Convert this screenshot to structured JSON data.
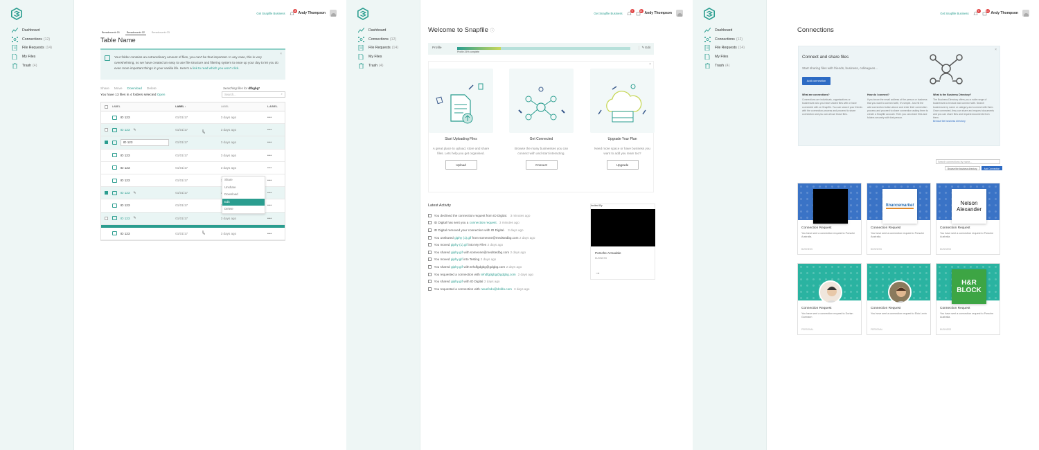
{
  "colors": {
    "teal": "#2a9d8f",
    "blue": "#2e6bc4",
    "sidebar_bg": "#eef6f5",
    "badge": "#e04040"
  },
  "header": {
    "get_business": "Get Snapfile Business",
    "user_name": "Andy Thompson",
    "notif_count": "14",
    "notif_count_a": "9",
    "notif_count_b": "14"
  },
  "nav": {
    "items": [
      {
        "label": "Dashboard",
        "count": ""
      },
      {
        "label": "Connections",
        "count": "(12)"
      },
      {
        "label": "File Requests",
        "count": "(14)"
      },
      {
        "label": "My Files",
        "count": ""
      },
      {
        "label": "Trash",
        "count": "(4)"
      }
    ]
  },
  "files": {
    "breadcrumbs": [
      "Breadcrumb 01",
      "Breadcrumb 02",
      "Breadcrumb 03"
    ],
    "title": "Table Name",
    "info_text": "Your folder contains an extraordinary amount of files, you can't be that important. In any case, this is very overwhelming, so we have created an easy to use file structure and filtering system to ease up your day to let you do even more important things in your vanilla life. Here's a",
    "info_link": "link to read which you won't click.",
    "actions": [
      "Share",
      "Move",
      "Download",
      "Delete"
    ],
    "selection_info": "You have 13 files in 4 folders selected",
    "selection_link": "Open",
    "search_label": "Searching files for",
    "search_term": "dfbgbg*",
    "search_placeholder": "Search...",
    "columns": [
      "LABEL",
      "LABEL ↑",
      "LABEL",
      "LABEL"
    ],
    "rows": [
      {
        "name": "ID 123",
        "date": "01/01/17",
        "modified": "3 days ago",
        "more": "•••"
      },
      {
        "name": "ID 123",
        "date": "01/01/17",
        "modified": "3 days ago",
        "more": "•••"
      },
      {
        "name": "ID 123",
        "date": "01/01/17",
        "modified": "3 days ago",
        "more": "•••"
      },
      {
        "name": "ID 123",
        "date": "01/01/17",
        "modified": "3 days ago",
        "more": "•••"
      },
      {
        "name": "ID 123",
        "date": "01/01/17",
        "modified": "3 days ago",
        "more": "•••"
      },
      {
        "name": "ID 123",
        "date": "01/01/17",
        "modified": "3 days ago",
        "more": "•••"
      },
      {
        "name": "ID 123",
        "date": "01/01/17",
        "modified": "3 days ago",
        "more": "•••"
      },
      {
        "name": "ID 123",
        "date": "01/01/17",
        "modified": "3 days ago",
        "more": "•••"
      },
      {
        "name": "ID 123",
        "date": "01/01/17",
        "modified": "3 days ago",
        "more": "•••"
      },
      {
        "name": "ID 123",
        "date": "01/01/17",
        "modified": "3 days ago",
        "more": "•••"
      }
    ],
    "context_menu": [
      "Share",
      "Unshare",
      "Download",
      "Edit",
      "Delete"
    ]
  },
  "dashboard": {
    "title": "Welcome to Snapfile",
    "profile_label": "Profile",
    "profile_percent": "Profile 25% complete",
    "profile_progress": 0.25,
    "edit": "Edit",
    "cards": [
      {
        "title": "Start Uploading Files",
        "desc": "A great place to upload, store and share files. Lets help you get organised.",
        "button": "Upload"
      },
      {
        "title": "Get Connected",
        "desc": "Browse the many businesses you can connect with and start interacting.",
        "button": "Connect"
      },
      {
        "title": "Upgrade Your Plan",
        "desc": "Need more space or have business you want to add you team too?",
        "button": "Upgrade"
      }
    ],
    "activity_title": "Latest Activity",
    "activity": [
      {
        "pre": "You declined the connection request from ID Digital.",
        "link": "",
        "post": "",
        "time": "3 minutes ago"
      },
      {
        "pre": "ID Digital has sent you a",
        "link": "connection request.",
        "post": "",
        "time": "3 minutes ago"
      },
      {
        "pre": "ID Digital removed your connection with ID Digital.",
        "link": "",
        "post": "",
        "time": "3 days ago"
      },
      {
        "pre": "You unshared",
        "link": "giphy (1).gif",
        "post": "from someone@medstedbg.com",
        "time": "2 days ago"
      },
      {
        "pre": "You moved",
        "link": "giphy (1).gif",
        "post": "into My Files",
        "time": "2 days ago"
      },
      {
        "pre": "You shared",
        "link": "giphy.gif",
        "post": "with someone@medstedbg.com",
        "time": "2 days ago"
      },
      {
        "pre": "You moved",
        "link": "giphy.gif",
        "post": "into Testing",
        "time": "2 days ago"
      },
      {
        "pre": "You shared",
        "link": "giphy.gif",
        "post": "with tehdfgdgbg@gdgbg.com",
        "time": "2 days ago"
      },
      {
        "pre": "You requested a connection with",
        "link": "tehdfgdgbg@gdgbg.com",
        "post": "",
        "time": "2 days ago"
      },
      {
        "pre": "You shared",
        "link": "giphy.gif",
        "post": "with ID Digital",
        "time": "2 days ago"
      },
      {
        "pre": "You requested a connection with",
        "link": "rwuefcdo@dofdo.com",
        "post": "",
        "time": "3 days ago"
      }
    ],
    "invited_label": "Invited By",
    "invited_name": "Porsche Armadale",
    "invited_sub": "BUSINESS",
    "invited_arrow": "→"
  },
  "connections": {
    "title": "Connections",
    "panel_title": "Connect and share files",
    "panel_sub": "Start sharing files with friends, business, colleagues...",
    "panel_button": "Add connection",
    "faq": [
      {
        "q": "What are connections?",
        "a": "Connections are individuals, organisations or businesses who you have shared files with or have connected with on Snapfile. You can search your friends with the connection process and proceed to share connection and you can all use those files.",
        "link": ""
      },
      {
        "q": "How do I connect?",
        "a": "If you know the email address of the person or business that you want to connect with, it's simple. Just hit the add connection button above and enter their connection process and proceed to share connection asking them to create a Snapfile account. Then you can share files and folders securely with that person.",
        "link": ""
      },
      {
        "q": "What is the Business Directory?",
        "a": "The Business Directory offers you a wide range of businesses to browse and connect with. Search businesses by name or category and connect with them. Once connected, they can share and request documents and you can share files and request documents from them.",
        "link": "Browse the business directory"
      }
    ],
    "search_placeholder": "Search connections by name...",
    "browse_button": "Browse the business directory",
    "add_button": "Add Connection",
    "cards": [
      {
        "title": "Connection Request",
        "desc": "You have sent a connection request to Porsche Australia.",
        "type": "BUSINESS",
        "logo": ""
      },
      {
        "title": "Connection Request",
        "desc": "You have sent a connection request to Porsche Australia.",
        "type": "BUSINESS",
        "logo": "financemarket"
      },
      {
        "title": "Connection Request",
        "desc": "You have sent a connection request to Porsche Australia.",
        "type": "BUSINESS",
        "logo": "Nelson Alexander"
      },
      {
        "title": "Connection Request",
        "desc": "You have sent a connection request to Dorian Gurmann",
        "type": "PERSONAL",
        "logo": ""
      },
      {
        "title": "Connection Request",
        "desc": "You have sent a connection request to Eldo Levin",
        "type": "PERSONAL",
        "logo": ""
      },
      {
        "title": "Connection Request",
        "desc": "You have sent a connection request to Porsche Australia.",
        "type": "BUSINESS",
        "logo": "H&R BLOCK"
      }
    ]
  }
}
